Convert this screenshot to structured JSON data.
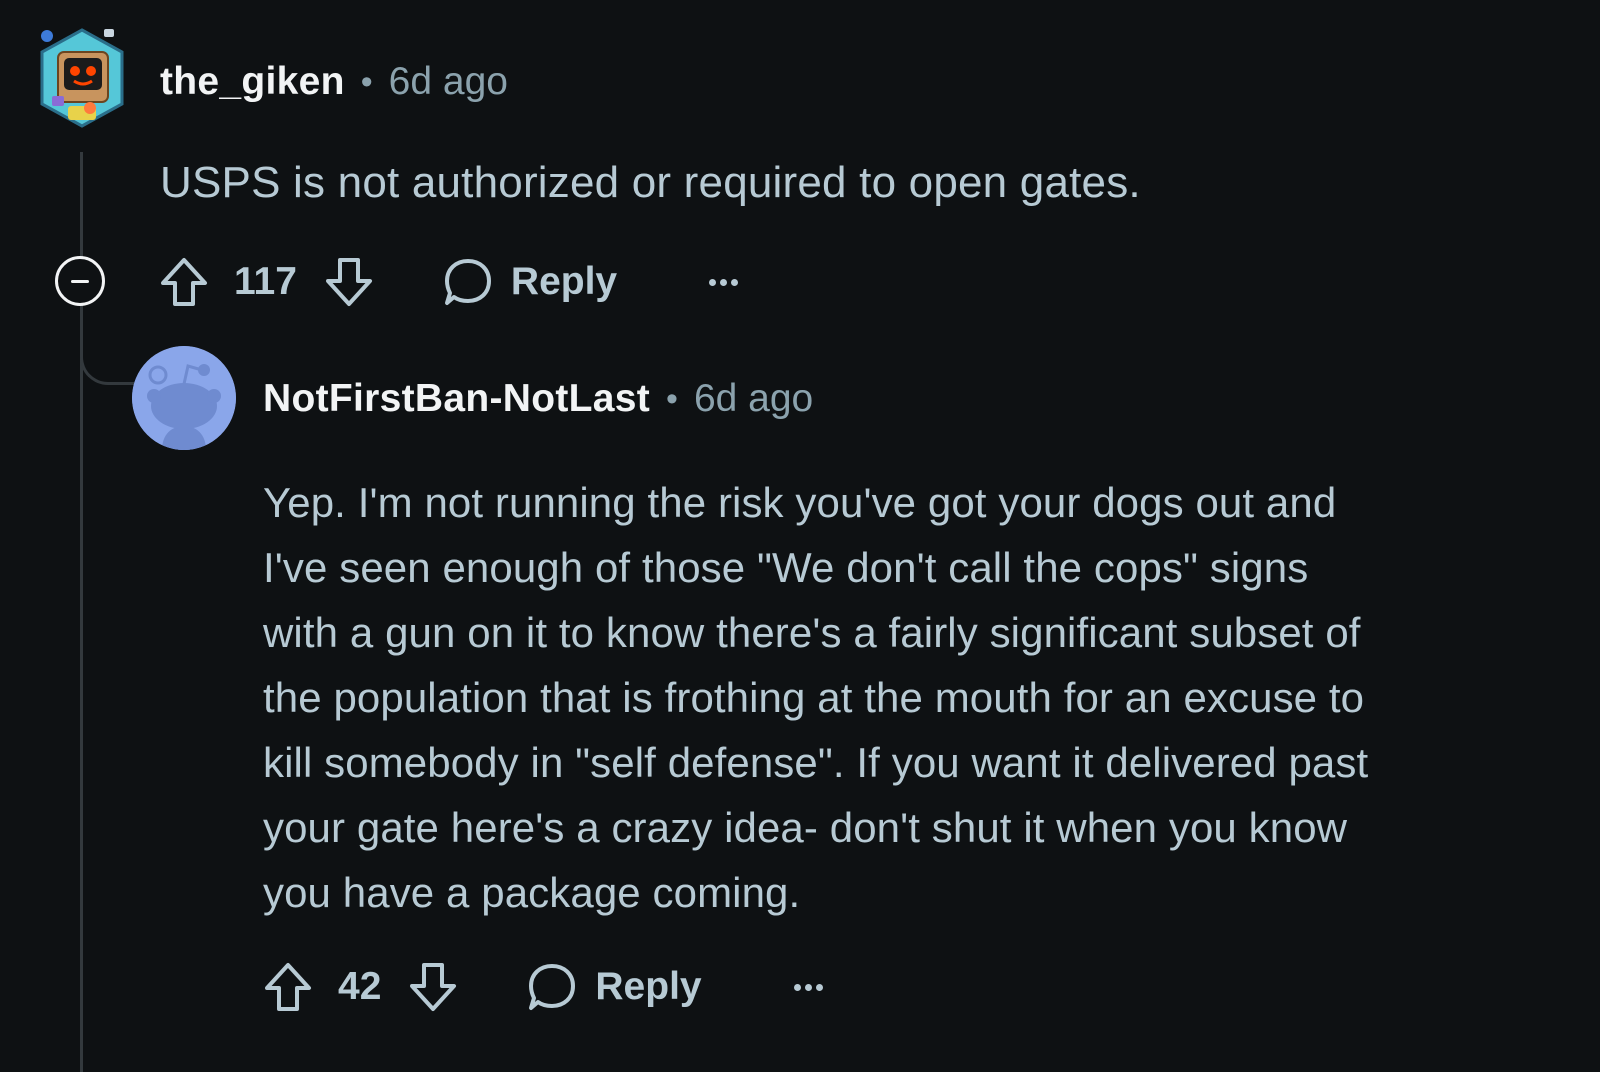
{
  "comments": [
    {
      "author": "the_giken",
      "separator": "•",
      "time": "6d ago",
      "avatar_icon": "robot-snoo-avatar-icon",
      "body": "USPS is not authorized or required to open gates.",
      "score": "117",
      "reply_label": "Reply"
    },
    {
      "author": "NotFirstBan-NotLast",
      "separator": "•",
      "time": "6d ago",
      "avatar_icon": "default-snoo-avatar-icon",
      "body_lines": [
        "Yep. I'm not running the risk you've got your dogs out and",
        "I've seen enough of those \"We don't call the cops\" signs",
        "with a gun on it to know there's a fairly significant subset of",
        "the population that is frothing at the mouth for an excuse to",
        "kill somebody in \"self defense\". If you want it delivered past",
        "your gate here's a crazy idea- don't shut it when you know",
        "you have a package coming."
      ],
      "score": "42",
      "reply_label": "Reply"
    }
  ],
  "colors": {
    "background": "#0e1113",
    "text": "#b7cad4",
    "username": "#f2f4f5",
    "meta": "#8ba2ad",
    "thread_line": "#33393d",
    "avatar_bg": "#8aa6ea"
  },
  "icons": {
    "collapse": "collapse-thread-icon",
    "upvote": "upvote-arrow-icon",
    "downvote": "downvote-arrow-icon",
    "reply": "speech-bubble-icon",
    "more": "more-options-icon"
  }
}
